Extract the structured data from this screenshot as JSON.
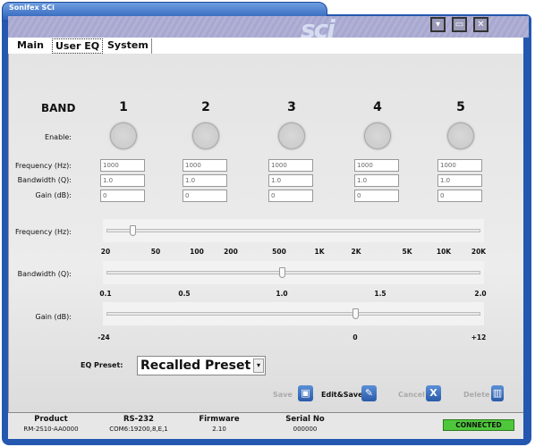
{
  "window": {
    "title": "Sonifex SCi",
    "logo": "sci",
    "controls": [
      "minimize-icon",
      "restore-icon",
      "close-icon"
    ]
  },
  "tabs": [
    {
      "label": "Main",
      "active": false
    },
    {
      "label": "User EQ",
      "active": true
    },
    {
      "label": "System",
      "active": false
    }
  ],
  "eq": {
    "band_label": "BAND",
    "row_labels": {
      "enable": "Enable:",
      "frequency": "Frequency (Hz):",
      "bandwidth": "Bandwidth (Q):",
      "gain": "Gain (dB):"
    },
    "bands": [
      {
        "number": "1",
        "enabled": false,
        "frequency": "1000",
        "bandwidth": "1.0",
        "gain": "0"
      },
      {
        "number": "2",
        "enabled": false,
        "frequency": "1000",
        "bandwidth": "1.0",
        "gain": "0"
      },
      {
        "number": "3",
        "enabled": false,
        "frequency": "1000",
        "bandwidth": "1.0",
        "gain": "0"
      },
      {
        "number": "4",
        "enabled": false,
        "frequency": "1000",
        "bandwidth": "1.0",
        "gain": "0"
      },
      {
        "number": "5",
        "enabled": false,
        "frequency": "1000",
        "bandwidth": "1.0",
        "gain": "0"
      }
    ]
  },
  "sliders": {
    "frequency": {
      "label": "Frequency (Hz):",
      "ticks": [
        "20",
        "50",
        "100",
        "200",
        "500",
        "1K",
        "2K",
        "5K",
        "10K",
        "20K"
      ],
      "position_fraction": 0.07
    },
    "bandwidth": {
      "label": "Bandwidth (Q):",
      "ticks": [
        "0.1",
        "0.5",
        "1.0",
        "1.5",
        "2.0"
      ],
      "position_fraction": 0.47
    },
    "gain": {
      "label": "Gain (dB):",
      "ticks": [
        "-24",
        "0",
        "+12"
      ],
      "position_fraction": 0.665
    }
  },
  "preset": {
    "label": "EQ Preset:",
    "value": "Recalled Preset"
  },
  "actions": {
    "save": "Save",
    "edit_save": "Edit&Save",
    "cancel": "Cancel",
    "delete": "Delete"
  },
  "status": {
    "product": {
      "label": "Product",
      "value": "RM-2S10-AA0000"
    },
    "rs232": {
      "label": "RS-232",
      "value": "COM6:19200,8,E,1"
    },
    "firmware": {
      "label": "Firmware",
      "value": "2.10"
    },
    "serial": {
      "label": "Serial No",
      "value": "000000"
    },
    "connection": "CONNECTED",
    "connection_color": "#4ec83a"
  }
}
